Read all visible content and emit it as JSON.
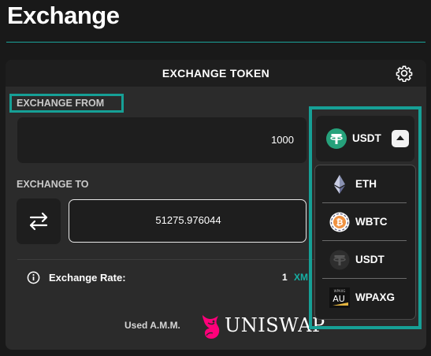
{
  "page": {
    "title": "Exchange"
  },
  "card": {
    "title": "EXCHANGE TOKEN"
  },
  "exchange_from": {
    "label": "EXCHANGE FROM",
    "amount": "1000"
  },
  "exchange_to": {
    "label": "EXCHANGE TO",
    "amount": "51275.976044"
  },
  "rate": {
    "label": "Exchange Rate:",
    "value": "1",
    "token_partial": "XM"
  },
  "amm": {
    "label": "Used A.M.M.",
    "name": "UNISWAP"
  },
  "token_selector": {
    "selected": "USDT",
    "selected_icon": "usdt-icon"
  },
  "token_menu": {
    "items": [
      {
        "label": "ETH",
        "icon": "eth-icon"
      },
      {
        "label": "WBTC",
        "icon": "wbtc-icon"
      },
      {
        "label": "USDT",
        "icon": "usdt-icon"
      },
      {
        "label": "WPAXG",
        "icon": "wpaxg-icon",
        "icon_text": "AU",
        "icon_caption": "WPAXG"
      }
    ]
  },
  "colors": {
    "background": "#191919",
    "card": "#2b2b2b",
    "field": "#1e1e1e",
    "accent_teal": "#16a096",
    "usdt_green": "#26a17b",
    "wbtc_orange": "#f09242",
    "uniswap_pink": "#ff007a"
  }
}
